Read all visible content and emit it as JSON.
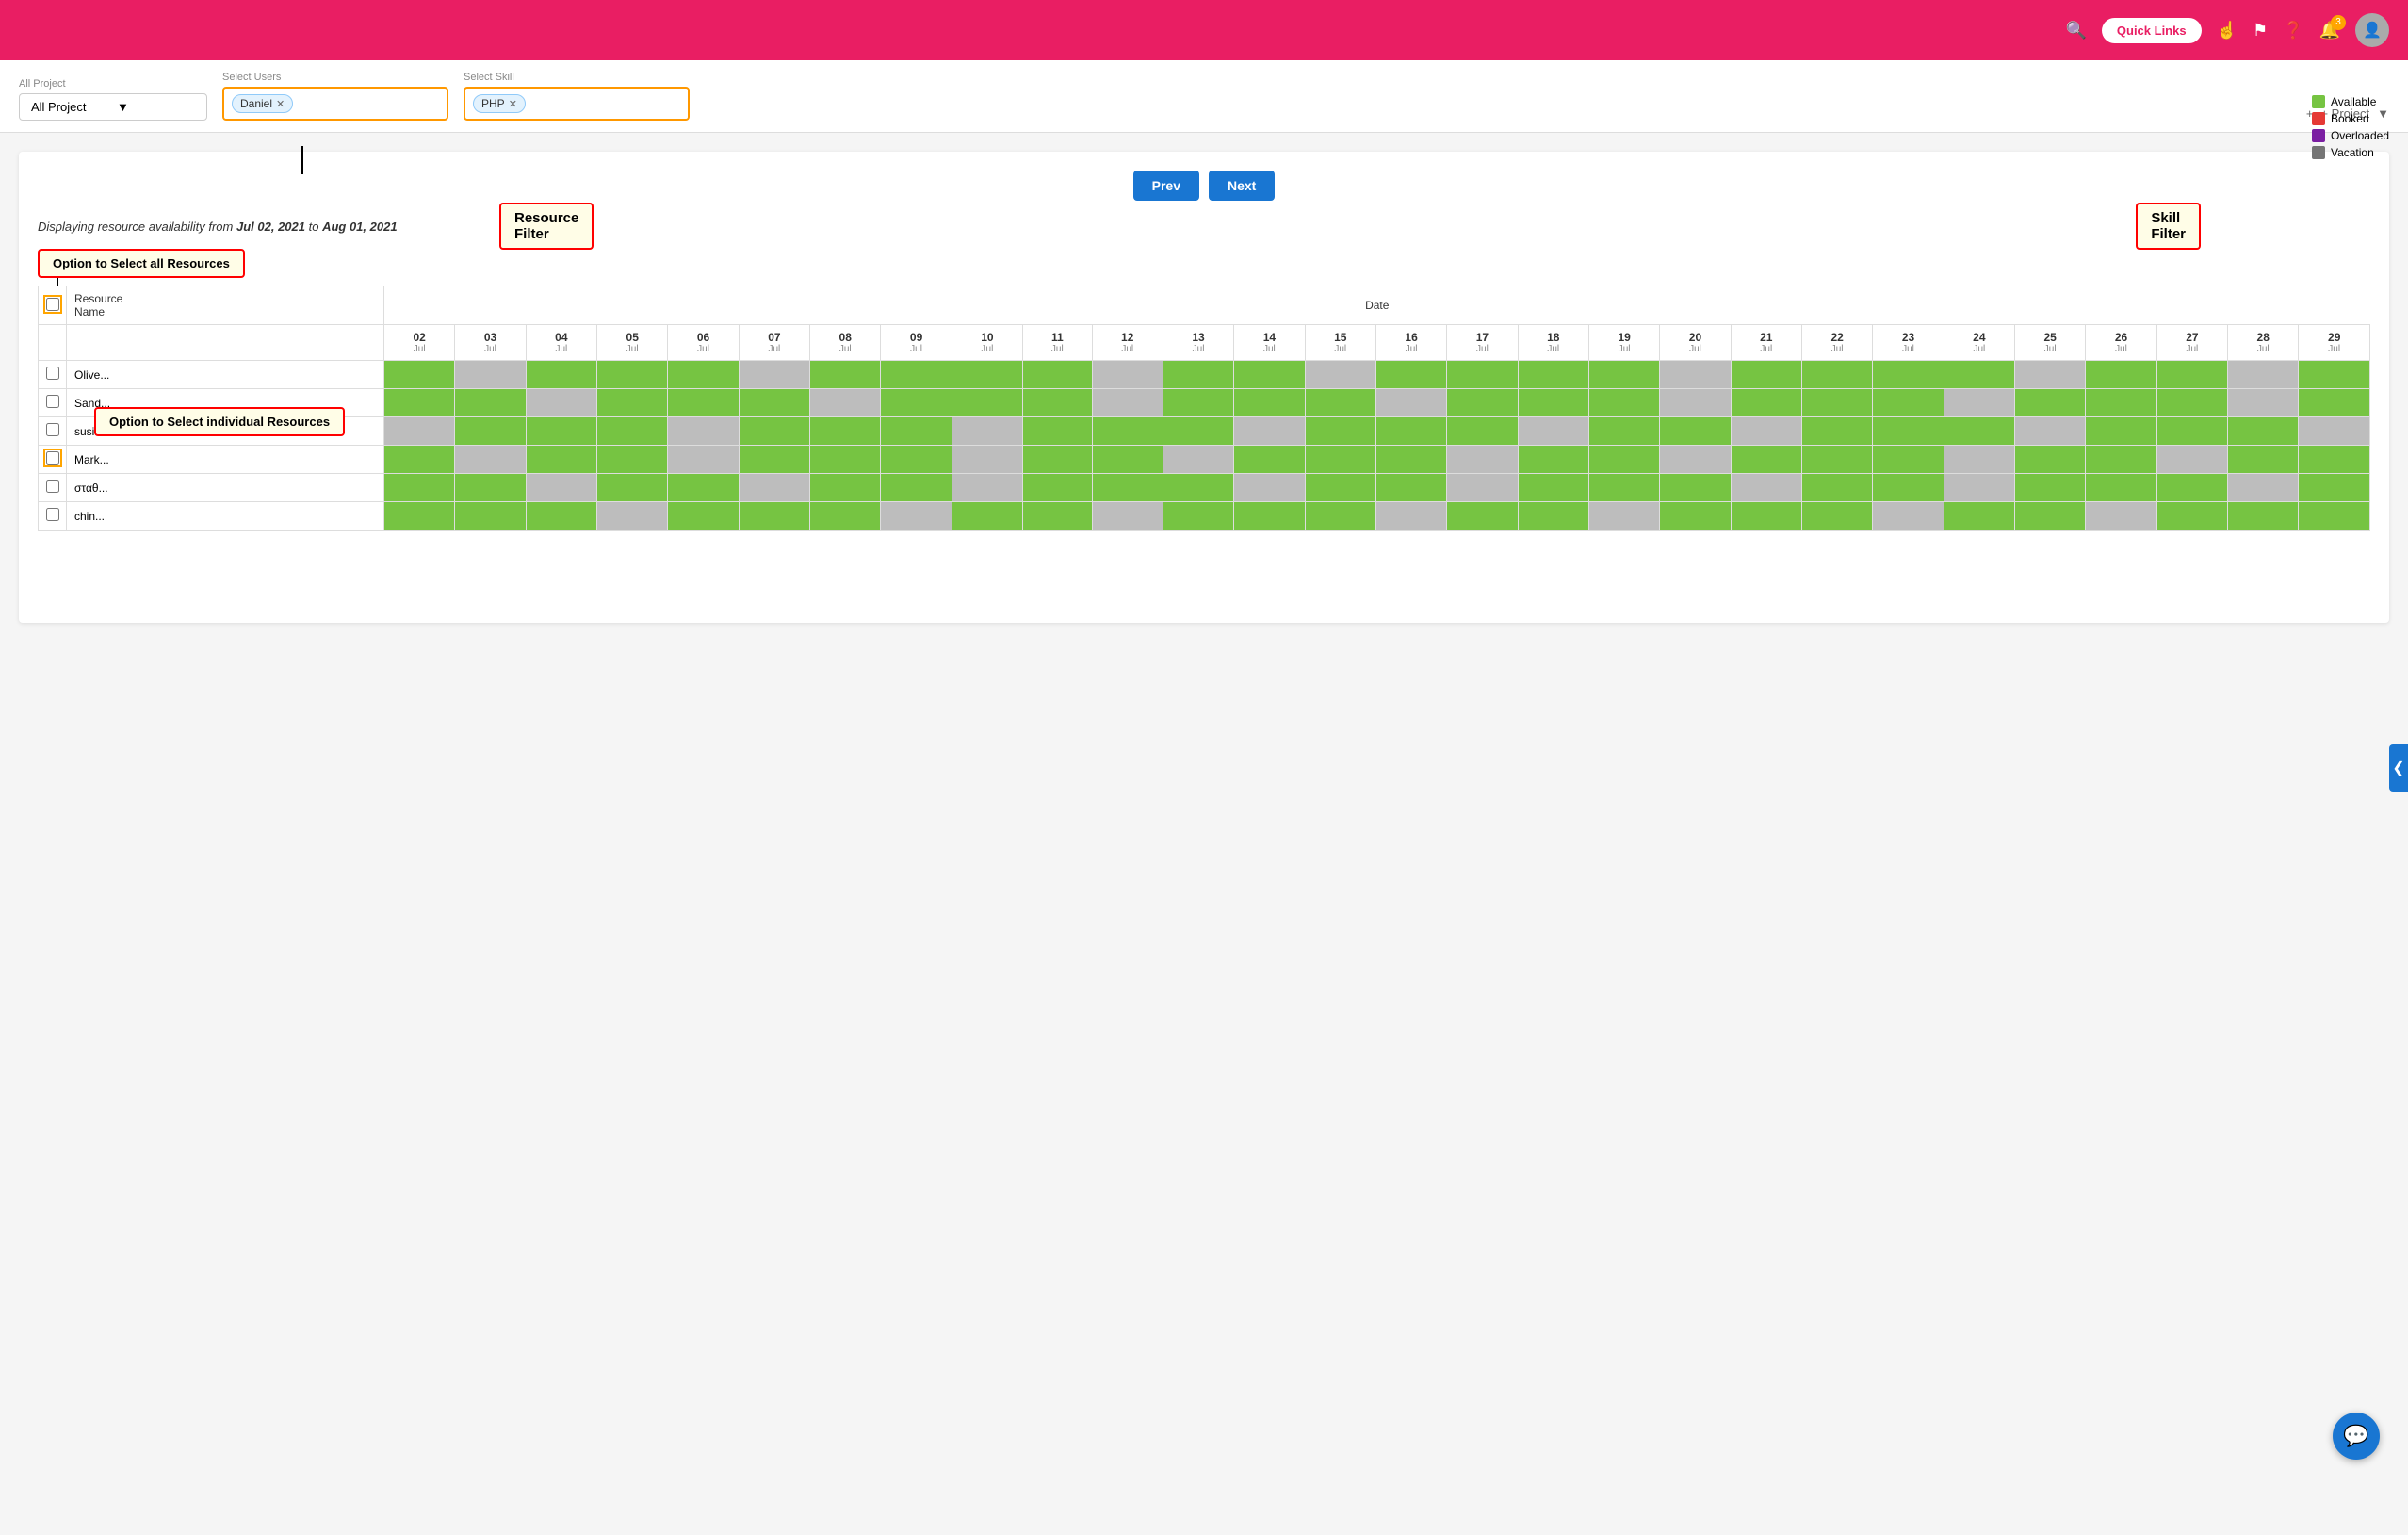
{
  "topNav": {
    "quickLinksLabel": "Quick Links",
    "notificationCount": "3"
  },
  "subNav": {
    "allProjectLabel": "All Project",
    "allProjectValue": "All Project",
    "selectUsersLabel": "Select Users",
    "userTag": "Daniel",
    "selectSkillLabel": "Select Skill",
    "skillTag": "PHP",
    "addProjectLabel": "+ Project"
  },
  "annotations": {
    "resourceFilter": "Resource Filter",
    "skillFilter": "Skill Filter",
    "selectAllResources": "Option to Select all Resources",
    "selectIndividual": "Option to Select individual Resources"
  },
  "nav": {
    "prevLabel": "Prev",
    "nextLabel": "Next"
  },
  "legend": {
    "items": [
      {
        "label": "Available",
        "color": "#76c442"
      },
      {
        "label": "Booked",
        "color": "#e53935"
      },
      {
        "label": "Overloaded",
        "color": "#7b1fa2"
      },
      {
        "label": "Vacation",
        "color": "#757575"
      }
    ]
  },
  "displayText": {
    "prefix": "Displaying resource availability from ",
    "from": "Jul 02, 2021",
    "to": " to ",
    "toDate": "Aug 01, 2021"
  },
  "table": {
    "dateHeader": "Date",
    "resourceNameHeader": "Resource\nName",
    "days": [
      {
        "num": "02",
        "month": "Jul"
      },
      {
        "num": "03",
        "month": "Jul"
      },
      {
        "num": "04",
        "month": "Jul"
      },
      {
        "num": "05",
        "month": "Jul"
      },
      {
        "num": "06",
        "month": "Jul"
      },
      {
        "num": "07",
        "month": "Jul"
      },
      {
        "num": "08",
        "month": "Jul"
      },
      {
        "num": "09",
        "month": "Jul"
      },
      {
        "num": "10",
        "month": "Jul"
      },
      {
        "num": "11",
        "month": "Jul"
      },
      {
        "num": "12",
        "month": "Jul"
      },
      {
        "num": "13",
        "month": "Jul"
      },
      {
        "num": "14",
        "month": "Jul"
      },
      {
        "num": "15",
        "month": "Jul"
      },
      {
        "num": "16",
        "month": "Jul"
      },
      {
        "num": "17",
        "month": "Jul"
      },
      {
        "num": "18",
        "month": "Jul"
      },
      {
        "num": "19",
        "month": "Jul"
      },
      {
        "num": "20",
        "month": "Jul"
      },
      {
        "num": "21",
        "month": "Jul"
      },
      {
        "num": "22",
        "month": "Jul"
      },
      {
        "num": "23",
        "month": "Jul"
      },
      {
        "num": "24",
        "month": "Jul"
      },
      {
        "num": "25",
        "month": "Jul"
      },
      {
        "num": "26",
        "month": "Jul"
      },
      {
        "num": "27",
        "month": "Jul"
      },
      {
        "num": "28",
        "month": "Jul"
      },
      {
        "num": "29",
        "month": "Jul"
      }
    ],
    "rows": [
      {
        "name": "Olive...",
        "cells": [
          "g",
          "x",
          "g",
          "g",
          "g",
          "x",
          "g",
          "g",
          "g",
          "g",
          "x",
          "g",
          "g",
          "x",
          "g",
          "g",
          "g",
          "g",
          "x",
          "g",
          "g",
          "g",
          "g",
          "x",
          "g",
          "g",
          "x",
          "g"
        ]
      },
      {
        "name": "Sand...",
        "cells": [
          "g",
          "g",
          "x",
          "g",
          "g",
          "g",
          "x",
          "g",
          "g",
          "g",
          "x",
          "g",
          "g",
          "g",
          "x",
          "g",
          "g",
          "g",
          "x",
          "g",
          "g",
          "g",
          "x",
          "g",
          "g",
          "g",
          "x",
          "g"
        ]
      },
      {
        "name": "susil...",
        "cells": [
          "x",
          "g",
          "g",
          "g",
          "x",
          "g",
          "g",
          "g",
          "x",
          "g",
          "g",
          "g",
          "x",
          "g",
          "g",
          "g",
          "x",
          "g",
          "g",
          "x",
          "g",
          "g",
          "g",
          "x",
          "g",
          "g",
          "g",
          "x"
        ]
      },
      {
        "name": "Mark...",
        "cells": [
          "g",
          "x",
          "g",
          "g",
          "x",
          "g",
          "g",
          "g",
          "x",
          "g",
          "g",
          "x",
          "g",
          "g",
          "g",
          "x",
          "g",
          "g",
          "x",
          "g",
          "g",
          "g",
          "x",
          "g",
          "g",
          "x",
          "g",
          "g"
        ]
      },
      {
        "name": "σταθ...",
        "cells": [
          "g",
          "g",
          "x",
          "g",
          "g",
          "x",
          "g",
          "g",
          "x",
          "g",
          "g",
          "g",
          "x",
          "g",
          "g",
          "x",
          "g",
          "g",
          "g",
          "x",
          "g",
          "g",
          "x",
          "g",
          "g",
          "g",
          "x",
          "g"
        ]
      },
      {
        "name": "chin...",
        "cells": [
          "g",
          "g",
          "g",
          "x",
          "g",
          "g",
          "g",
          "x",
          "g",
          "g",
          "x",
          "g",
          "g",
          "g",
          "x",
          "g",
          "g",
          "x",
          "g",
          "g",
          "g",
          "x",
          "g",
          "g",
          "x",
          "g",
          "g",
          "g"
        ]
      }
    ]
  }
}
